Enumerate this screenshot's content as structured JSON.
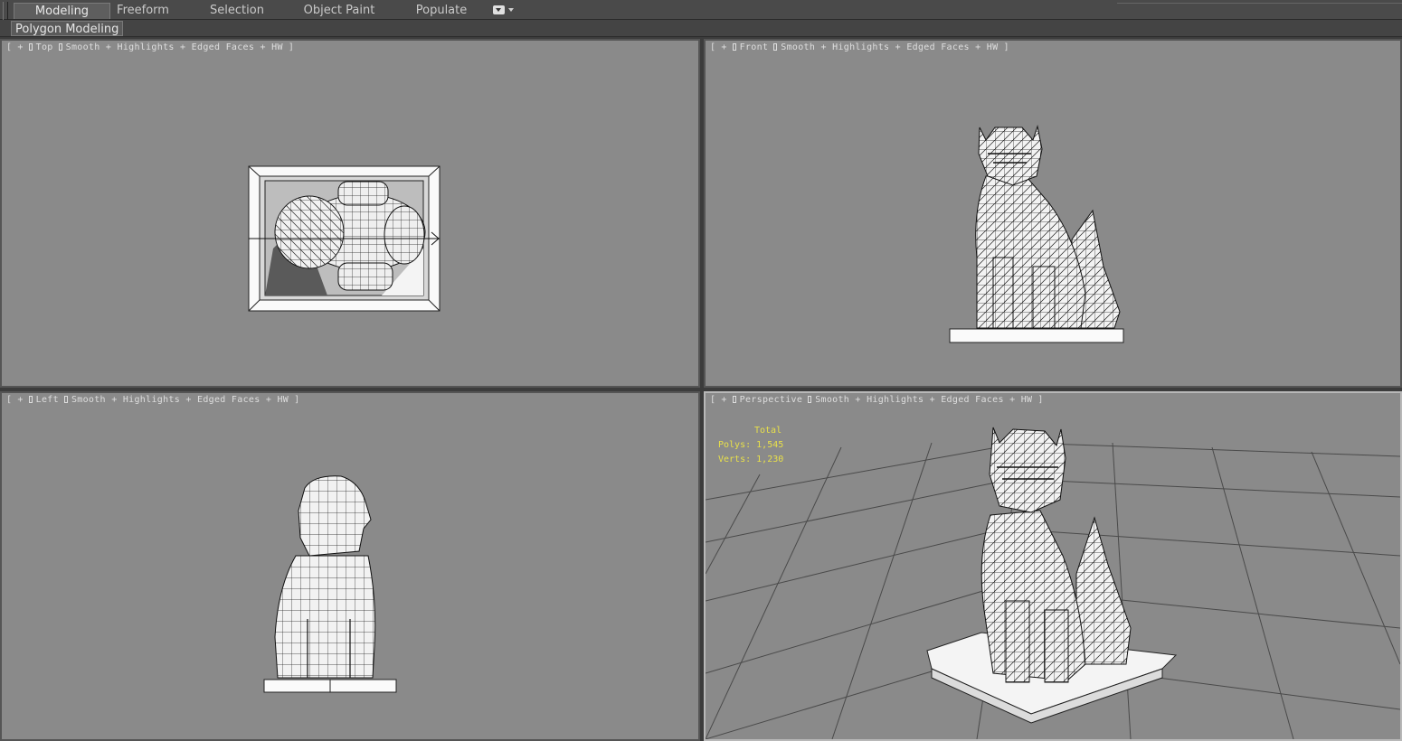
{
  "ribbon": {
    "tabs": [
      "Modeling",
      "Freeform",
      "Selection",
      "Object Paint",
      "Populate"
    ],
    "active_tab": "Modeling",
    "panel_label": "Polygon Modeling",
    "menu_icon": "dropdown-arrow-icon"
  },
  "viewports": {
    "top": {
      "open": "[",
      "plus": "+",
      "name": "Top",
      "shading": "Smooth + Highlights + Edged Faces + HW",
      "close": "]"
    },
    "front": {
      "open": "[",
      "plus": "+",
      "name": "Front",
      "shading": "Smooth + Highlights + Edged Faces + HW",
      "close": "]"
    },
    "left": {
      "open": "[",
      "plus": "+",
      "name": "Left",
      "shading": "Smooth + Highlights + Edged Faces + HW",
      "close": "]"
    },
    "perspective": {
      "open": "[",
      "plus": "+",
      "name": "Perspective",
      "shading": "Smooth + Highlights + Edged Faces + HW",
      "close": "]"
    }
  },
  "stats": {
    "total_label": "Total",
    "polys_label": "Polys:",
    "polys_value": "1,545",
    "verts_label": "Verts:",
    "verts_value": "1,230"
  },
  "colors": {
    "viewport_bg": "#8a8a8a",
    "stats_text": "#e8e04a",
    "active_border": "#b8b8b8"
  }
}
